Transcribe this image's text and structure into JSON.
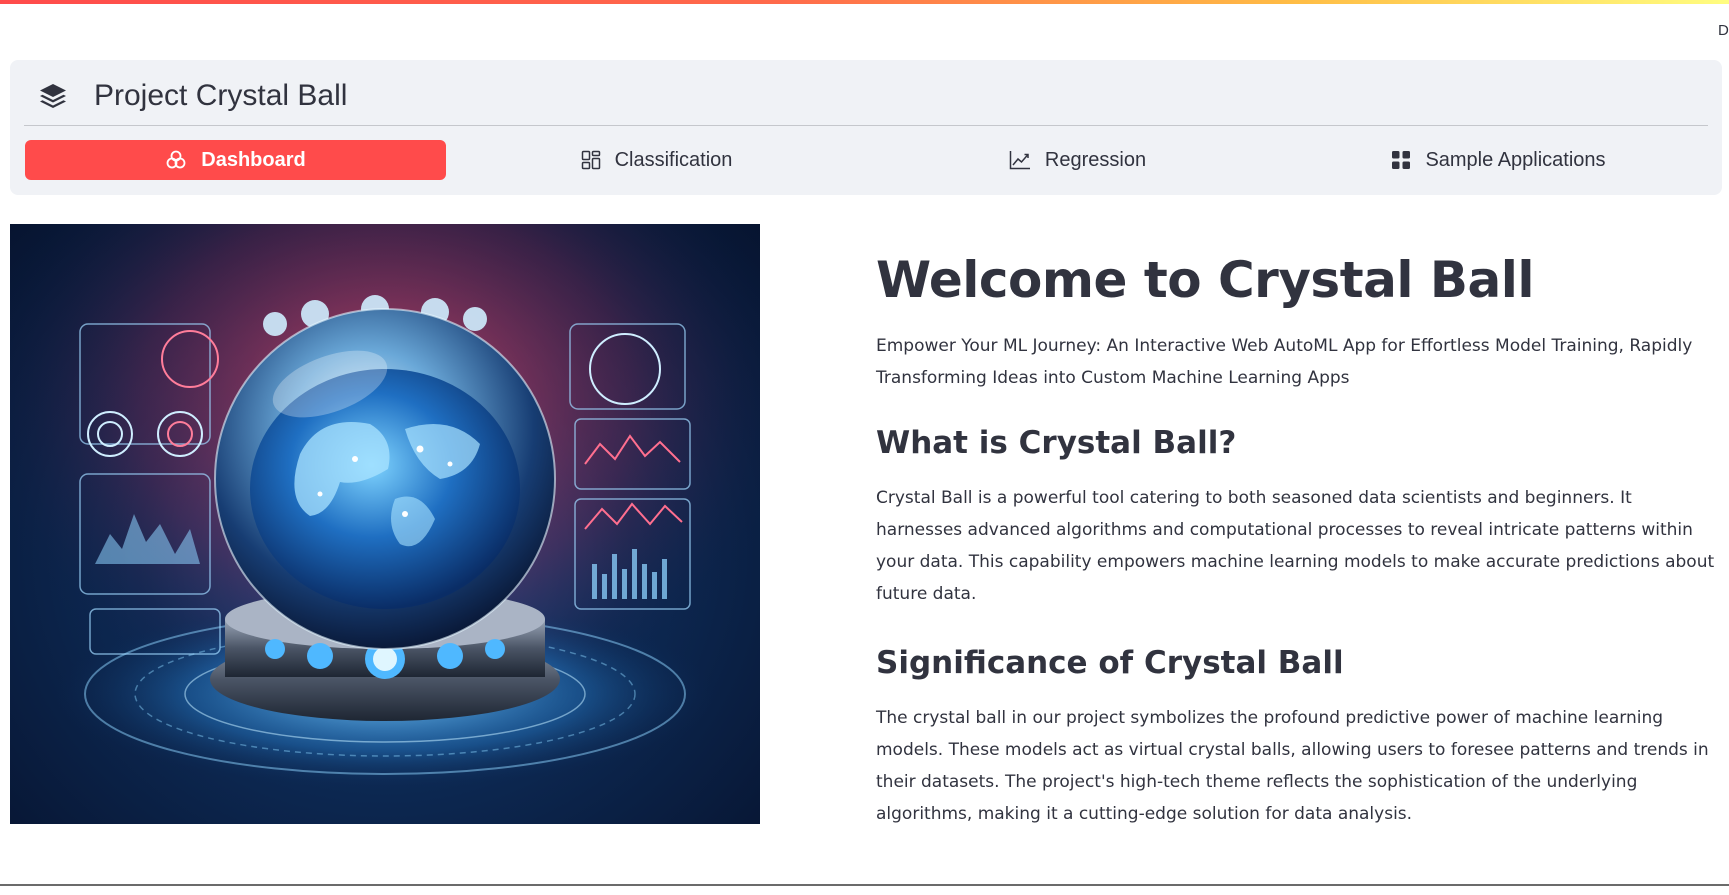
{
  "deploy_label": "Deploy",
  "menu": {
    "title": "Project Crystal Ball",
    "icon": "layers-icon",
    "items": [
      {
        "label": "Dashboard",
        "icon": "flower-icon",
        "active": true
      },
      {
        "label": "Classification",
        "icon": "grid-layout-icon",
        "active": false
      },
      {
        "label": "Regression",
        "icon": "graph-up-icon",
        "active": false
      },
      {
        "label": "Sample Applications",
        "icon": "grid-fill-icon",
        "active": false
      }
    ]
  },
  "main": {
    "welcome": "Welcome to Crystal Ball",
    "tagline": "Empower Your ML Journey: An Interactive Web AutoML App for Effortless Model Training, Rapidly Transforming Ideas into Custom Machine Learning Apps",
    "section1_title": "What is Crystal Ball?",
    "section1_text": "Crystal Ball is a powerful tool catering to both seasoned data scientists and beginners. It harnesses advanced algorithms and computational processes to reveal intricate patterns within your data. This capability empowers machine learning models to make accurate predictions about future data.",
    "section2_title": "Significance of Crystal Ball",
    "section2_text": "The crystal ball in our project symbolizes the profound predictive power of machine learning models. These models act as virtual crystal balls, allowing users to foresee patterns and trends in their datasets. The project's high-tech theme reflects the sophistication of the underlying algorithms, making it a cutting-edge solution for data analysis."
  },
  "colors": {
    "accent": "#ff4b4b",
    "menu_bg": "#f0f2f6",
    "text": "#31333f"
  }
}
